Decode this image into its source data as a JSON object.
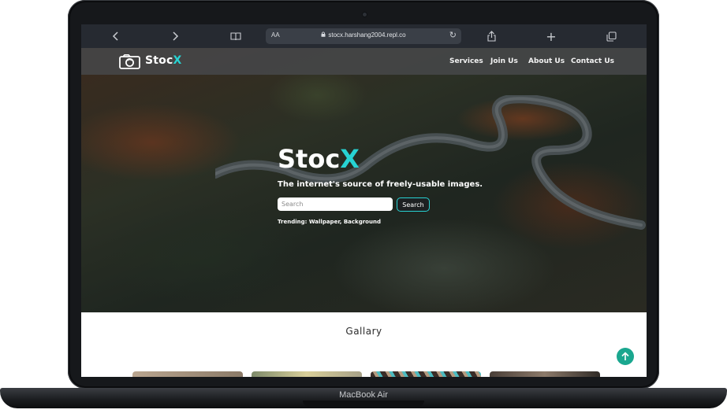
{
  "device": {
    "label": "MacBook Air"
  },
  "browser": {
    "text_size_label": "AA",
    "url": "stocx.harshang2004.repl.co",
    "buttons": [
      "back-icon",
      "forward-icon",
      "bookmarks-icon",
      "reload-icon",
      "share-icon",
      "new-tab-icon",
      "tabs-icon"
    ]
  },
  "site": {
    "logo": {
      "name": "Stoc",
      "accent_letter": "X"
    },
    "nav": [
      "Services",
      "Join Us",
      "About Us",
      "Contact Us"
    ],
    "hero": {
      "title": "Stoc",
      "title_accent": "X",
      "subtitle": "The internet's source of freely-usable images.",
      "search_placeholder": "Search",
      "search_button": "Search",
      "trending": "Trending: Wallpaper, Background"
    },
    "gallery": {
      "title": "Gallary"
    },
    "scroll_top_icon": "arrow-up-icon"
  },
  "colors": {
    "accent": "#27d3d3",
    "scroll_top": "#1aa78f",
    "browser_bar": "#262a31",
    "navbar": "#46484a"
  }
}
